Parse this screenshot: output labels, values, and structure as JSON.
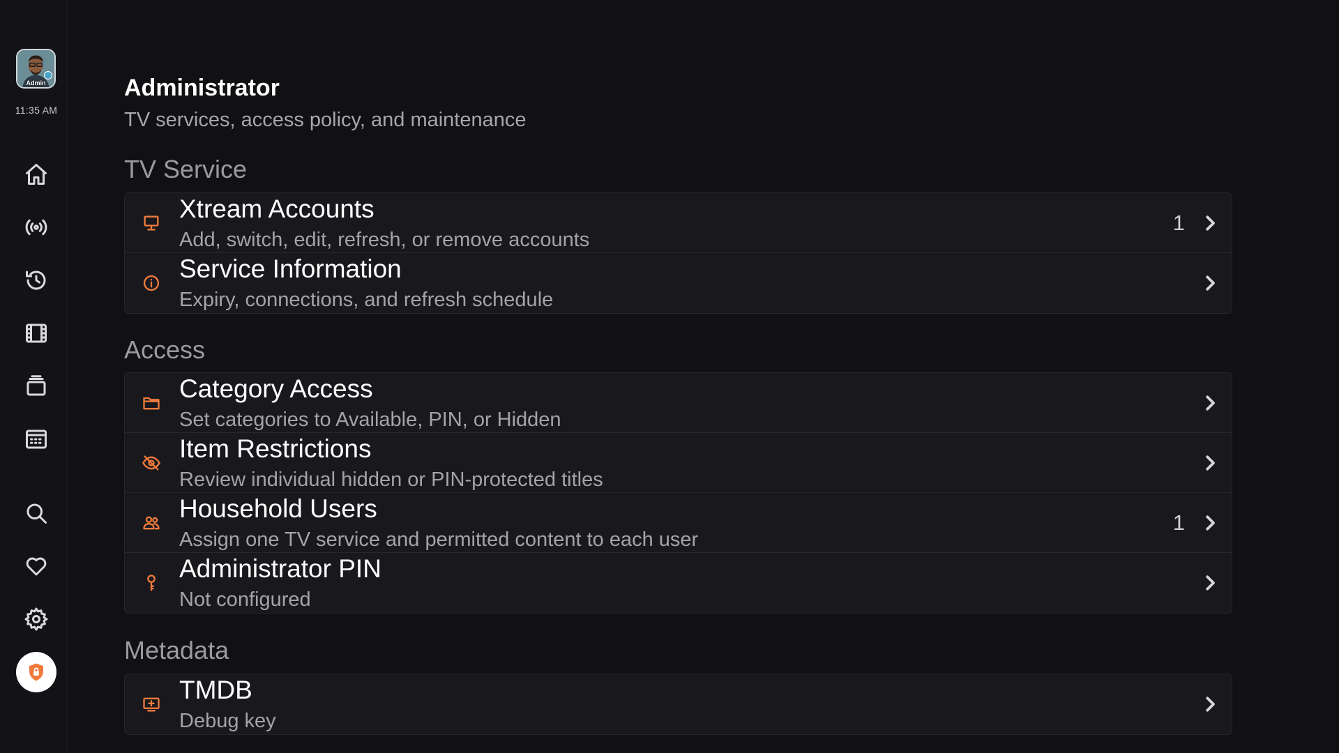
{
  "sidebar": {
    "profile_label": "Admin",
    "clock": "11:35 AM",
    "nav": [
      {
        "icon": "home-icon"
      },
      {
        "icon": "live-broadcast-icon"
      },
      {
        "icon": "history-icon"
      },
      {
        "icon": "film-icon"
      },
      {
        "icon": "series-stack-icon"
      },
      {
        "icon": "calendar-guide-icon"
      },
      {
        "icon": "search-icon"
      },
      {
        "icon": "heart-icon"
      },
      {
        "icon": "gear-icon"
      },
      {
        "icon": "lock-icon",
        "active": true
      }
    ]
  },
  "header": {
    "title": "Administrator",
    "subtitle": "TV services, access policy, and maintenance"
  },
  "sections": {
    "tv_service": {
      "title": "TV Service",
      "rows": [
        {
          "icon": "monitor-icon",
          "title": "Xtream Accounts",
          "subtitle": "Add, switch, edit, refresh, or remove accounts",
          "count": "1"
        },
        {
          "icon": "info-icon",
          "title": "Service Information",
          "subtitle": "Expiry, connections, and refresh schedule"
        }
      ]
    },
    "access": {
      "title": "Access",
      "rows": [
        {
          "icon": "folder-icon",
          "title": "Category Access",
          "subtitle": "Set categories to Available, PIN, or Hidden"
        },
        {
          "icon": "eye-off-icon",
          "title": "Item Restrictions",
          "subtitle": "Review individual hidden or PIN-protected titles"
        },
        {
          "icon": "users-icon",
          "title": "Household Users",
          "subtitle": "Assign one TV service and permitted content to each user",
          "count": "1"
        },
        {
          "icon": "key-icon",
          "title": "Administrator PIN",
          "subtitle": "Not configured"
        }
      ]
    },
    "metadata": {
      "title": "Metadata",
      "rows": [
        {
          "icon": "tv-add-icon",
          "title": "TMDB",
          "subtitle": "Debug key"
        }
      ]
    }
  },
  "colors": {
    "background": "#111114",
    "card": "#19191d",
    "accent": "#ef7a3c",
    "secondary_text": "#a3a3aa"
  }
}
